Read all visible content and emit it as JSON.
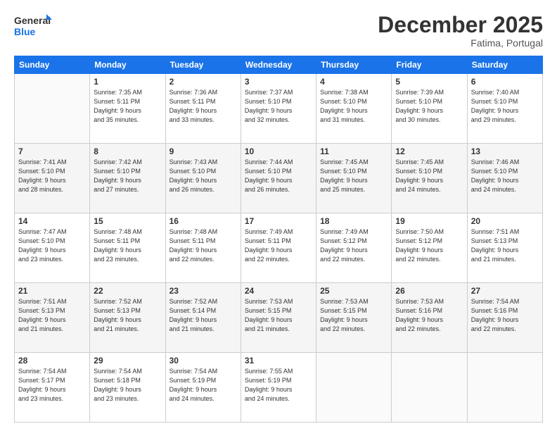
{
  "logo": {
    "line1": "General",
    "line2": "Blue"
  },
  "title": "December 2025",
  "subtitle": "Fatima, Portugal",
  "days_header": [
    "Sunday",
    "Monday",
    "Tuesday",
    "Wednesday",
    "Thursday",
    "Friday",
    "Saturday"
  ],
  "weeks": [
    [
      {
        "day": "",
        "info": ""
      },
      {
        "day": "1",
        "info": "Sunrise: 7:35 AM\nSunset: 5:11 PM\nDaylight: 9 hours\nand 35 minutes."
      },
      {
        "day": "2",
        "info": "Sunrise: 7:36 AM\nSunset: 5:11 PM\nDaylight: 9 hours\nand 33 minutes."
      },
      {
        "day": "3",
        "info": "Sunrise: 7:37 AM\nSunset: 5:10 PM\nDaylight: 9 hours\nand 32 minutes."
      },
      {
        "day": "4",
        "info": "Sunrise: 7:38 AM\nSunset: 5:10 PM\nDaylight: 9 hours\nand 31 minutes."
      },
      {
        "day": "5",
        "info": "Sunrise: 7:39 AM\nSunset: 5:10 PM\nDaylight: 9 hours\nand 30 minutes."
      },
      {
        "day": "6",
        "info": "Sunrise: 7:40 AM\nSunset: 5:10 PM\nDaylight: 9 hours\nand 29 minutes."
      }
    ],
    [
      {
        "day": "7",
        "info": "Sunrise: 7:41 AM\nSunset: 5:10 PM\nDaylight: 9 hours\nand 28 minutes."
      },
      {
        "day": "8",
        "info": "Sunrise: 7:42 AM\nSunset: 5:10 PM\nDaylight: 9 hours\nand 27 minutes."
      },
      {
        "day": "9",
        "info": "Sunrise: 7:43 AM\nSunset: 5:10 PM\nDaylight: 9 hours\nand 26 minutes."
      },
      {
        "day": "10",
        "info": "Sunrise: 7:44 AM\nSunset: 5:10 PM\nDaylight: 9 hours\nand 26 minutes."
      },
      {
        "day": "11",
        "info": "Sunrise: 7:45 AM\nSunset: 5:10 PM\nDaylight: 9 hours\nand 25 minutes."
      },
      {
        "day": "12",
        "info": "Sunrise: 7:45 AM\nSunset: 5:10 PM\nDaylight: 9 hours\nand 24 minutes."
      },
      {
        "day": "13",
        "info": "Sunrise: 7:46 AM\nSunset: 5:10 PM\nDaylight: 9 hours\nand 24 minutes."
      }
    ],
    [
      {
        "day": "14",
        "info": "Sunrise: 7:47 AM\nSunset: 5:10 PM\nDaylight: 9 hours\nand 23 minutes."
      },
      {
        "day": "15",
        "info": "Sunrise: 7:48 AM\nSunset: 5:11 PM\nDaylight: 9 hours\nand 23 minutes."
      },
      {
        "day": "16",
        "info": "Sunrise: 7:48 AM\nSunset: 5:11 PM\nDaylight: 9 hours\nand 22 minutes."
      },
      {
        "day": "17",
        "info": "Sunrise: 7:49 AM\nSunset: 5:11 PM\nDaylight: 9 hours\nand 22 minutes."
      },
      {
        "day": "18",
        "info": "Sunrise: 7:49 AM\nSunset: 5:12 PM\nDaylight: 9 hours\nand 22 minutes."
      },
      {
        "day": "19",
        "info": "Sunrise: 7:50 AM\nSunset: 5:12 PM\nDaylight: 9 hours\nand 22 minutes."
      },
      {
        "day": "20",
        "info": "Sunrise: 7:51 AM\nSunset: 5:13 PM\nDaylight: 9 hours\nand 21 minutes."
      }
    ],
    [
      {
        "day": "21",
        "info": "Sunrise: 7:51 AM\nSunset: 5:13 PM\nDaylight: 9 hours\nand 21 minutes."
      },
      {
        "day": "22",
        "info": "Sunrise: 7:52 AM\nSunset: 5:13 PM\nDaylight: 9 hours\nand 21 minutes."
      },
      {
        "day": "23",
        "info": "Sunrise: 7:52 AM\nSunset: 5:14 PM\nDaylight: 9 hours\nand 21 minutes."
      },
      {
        "day": "24",
        "info": "Sunrise: 7:53 AM\nSunset: 5:15 PM\nDaylight: 9 hours\nand 21 minutes."
      },
      {
        "day": "25",
        "info": "Sunrise: 7:53 AM\nSunset: 5:15 PM\nDaylight: 9 hours\nand 22 minutes."
      },
      {
        "day": "26",
        "info": "Sunrise: 7:53 AM\nSunset: 5:16 PM\nDaylight: 9 hours\nand 22 minutes."
      },
      {
        "day": "27",
        "info": "Sunrise: 7:54 AM\nSunset: 5:16 PM\nDaylight: 9 hours\nand 22 minutes."
      }
    ],
    [
      {
        "day": "28",
        "info": "Sunrise: 7:54 AM\nSunset: 5:17 PM\nDaylight: 9 hours\nand 23 minutes."
      },
      {
        "day": "29",
        "info": "Sunrise: 7:54 AM\nSunset: 5:18 PM\nDaylight: 9 hours\nand 23 minutes."
      },
      {
        "day": "30",
        "info": "Sunrise: 7:54 AM\nSunset: 5:19 PM\nDaylight: 9 hours\nand 24 minutes."
      },
      {
        "day": "31",
        "info": "Sunrise: 7:55 AM\nSunset: 5:19 PM\nDaylight: 9 hours\nand 24 minutes."
      },
      {
        "day": "",
        "info": ""
      },
      {
        "day": "",
        "info": ""
      },
      {
        "day": "",
        "info": ""
      }
    ]
  ]
}
